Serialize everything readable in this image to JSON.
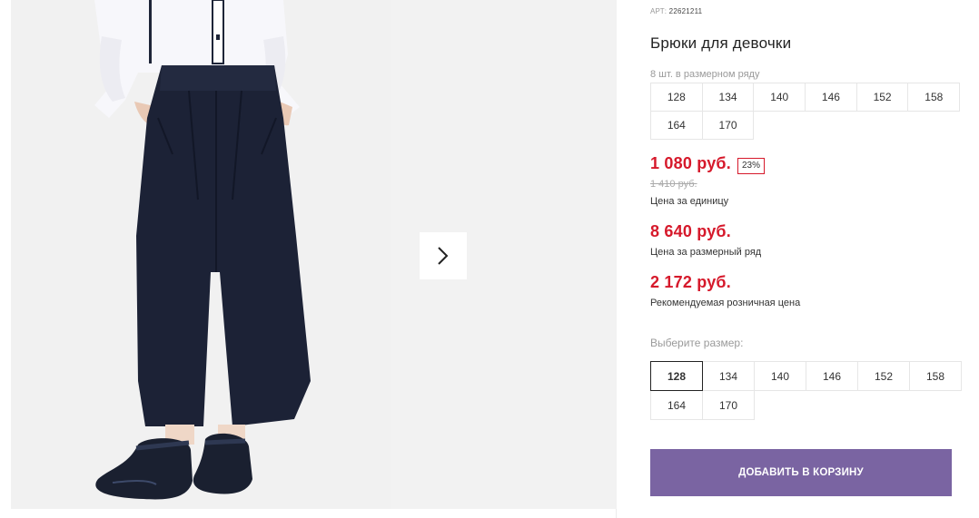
{
  "product": {
    "article_label": "АРТ:",
    "article_value": "22621211",
    "title": "Брюки для девочки",
    "pack_note": "8 шт. в размерном ряду",
    "pack_sizes": [
      "128",
      "134",
      "140",
      "146",
      "152",
      "158",
      "164",
      "170"
    ]
  },
  "prices": {
    "unit_price": "1 080 руб.",
    "discount": "23%",
    "old_price": "1 410 руб.",
    "unit_label": "Цена за единицу",
    "pack_price": "8 640 руб.",
    "pack_label": "Цена за размерный ряд",
    "retail_price": "2 172 руб.",
    "retail_label": "Рекомендуемая розничная цена"
  },
  "size_select": {
    "label": "Выберите размер:",
    "selected": "128",
    "options": [
      "128",
      "134",
      "140",
      "146",
      "152",
      "158",
      "164",
      "170"
    ]
  },
  "cart_button": "ДОБАВИТЬ В КОРЗИНУ",
  "colors": {
    "accent_red": "#d6192b",
    "cart_button": "#7a64a2"
  },
  "icons": {
    "gallery_next": "chevron-right-icon"
  }
}
